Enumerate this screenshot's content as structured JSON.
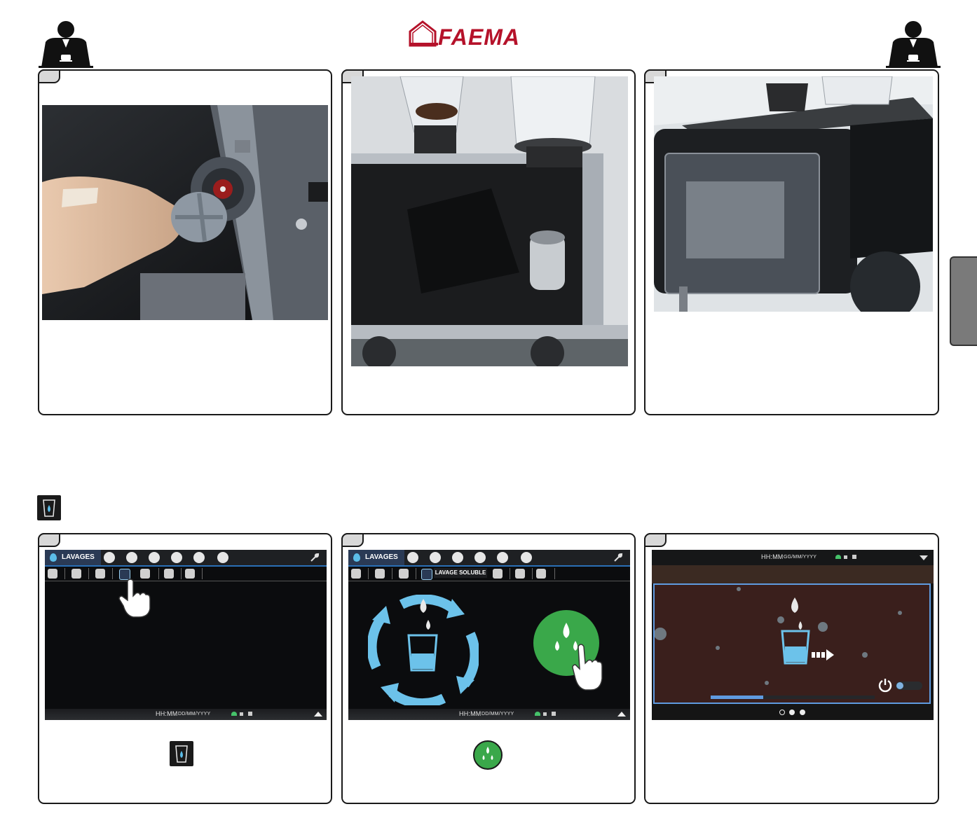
{
  "header": {
    "brand": "FAEMA"
  },
  "screens": {
    "lavages_label": "LAVAGES",
    "lavage_soluble_label": "LAVAGE SOLUBLE",
    "time_format": "HH:MM",
    "date_format": "DD/MM/YYYY",
    "time_format_alt": "HH:MM",
    "date_format_alt": "GG/MM/YYYY"
  },
  "colors": {
    "brand": "#b5122a",
    "water_blue": "#5bbde8",
    "green": "#3aa84a",
    "screen_bg": "#0b0c0e",
    "brown_bg": "#3a1f1c",
    "highlight_blue": "#2a6fb5"
  },
  "icons": {
    "section_icon": "glass-water-icon",
    "operator_icon": "operator-icon"
  }
}
